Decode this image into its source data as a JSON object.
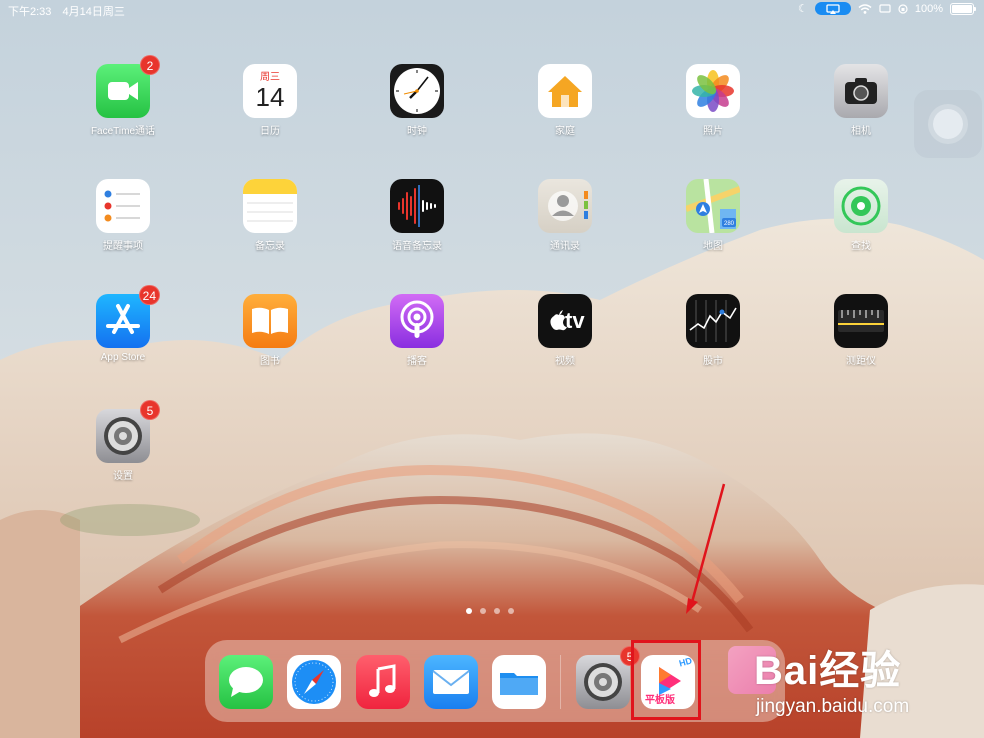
{
  "status_bar": {
    "time": "下午2:33",
    "date": "4月14日周三",
    "battery": "100%"
  },
  "calendar_icon": {
    "weekday": "周三",
    "day": "14"
  },
  "apps": [
    {
      "label": "FaceTime通话",
      "badge": "2"
    },
    {
      "label": "日历"
    },
    {
      "label": "时钟"
    },
    {
      "label": "家庭"
    },
    {
      "label": "照片"
    },
    {
      "label": "相机"
    },
    {
      "label": "提醒事项"
    },
    {
      "label": "备忘录"
    },
    {
      "label": "语音备忘录"
    },
    {
      "label": "通讯录"
    },
    {
      "label": "地图"
    },
    {
      "label": "查找"
    },
    {
      "label": "App Store",
      "badge": "24"
    },
    {
      "label": "图书"
    },
    {
      "label": "播客"
    },
    {
      "label": "视频"
    },
    {
      "label": "股市"
    },
    {
      "label": "测距仪"
    },
    {
      "label": "设置",
      "badge": "5"
    }
  ],
  "appletv_text": "tv",
  "maps_shield": "280",
  "dock": {
    "settings_badge": "5",
    "video_hd_text": "HD",
    "video_app_text": "平板版"
  },
  "watermark": {
    "logo": "Bai经验",
    "url": "jingyan.baidu.com"
  },
  "colors": {
    "badge": "#e8352c",
    "highlight": "#e0141c",
    "airplay": "#1a8cf2"
  }
}
